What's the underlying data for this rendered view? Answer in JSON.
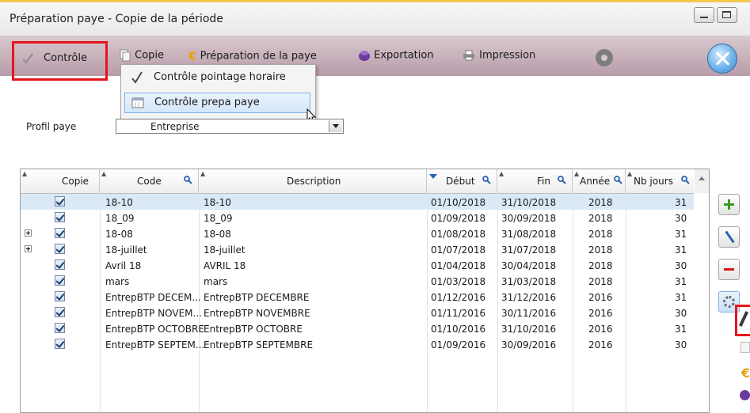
{
  "window": {
    "title": "Préparation paye - Copie de la période"
  },
  "toolbar": {
    "controle_label": "Contrôle",
    "copie_label": "Copie",
    "preparation_label": "Préparation de la paye",
    "exportation_label": "Exportation",
    "impression_label": "Impression"
  },
  "dropdown_menu": {
    "items": [
      {
        "label": "Contrôle pointage horaire",
        "icon": "checkmark-icon"
      },
      {
        "label": "Contrôle prepa paye",
        "icon": "calendar-icon"
      }
    ]
  },
  "profil": {
    "label": "Profil paye",
    "value": "Entreprise"
  },
  "grid": {
    "headers": [
      "Copie",
      "Code",
      "Description",
      "Début",
      "Fin",
      "Année",
      "Nb jours"
    ],
    "rows": [
      {
        "expand": false,
        "copie": true,
        "code": "18-10",
        "description": "18-10",
        "debut": "01/10/2018",
        "fin": "31/10/2018",
        "annee": "2018",
        "nbjours": "31"
      },
      {
        "expand": false,
        "copie": true,
        "code": "18_09",
        "description": "18_09",
        "debut": "01/09/2018",
        "fin": "30/09/2018",
        "annee": "2018",
        "nbjours": "30"
      },
      {
        "expand": true,
        "copie": true,
        "code": "18-08",
        "description": "18-08",
        "debut": "01/08/2018",
        "fin": "31/08/2018",
        "annee": "2018",
        "nbjours": "31"
      },
      {
        "expand": true,
        "copie": true,
        "code": "18-juillet",
        "description": "18-juillet",
        "debut": "01/07/2018",
        "fin": "31/07/2018",
        "annee": "2018",
        "nbjours": "31"
      },
      {
        "expand": false,
        "copie": true,
        "code": "Avril 18",
        "description": "AVRIL 18",
        "debut": "01/04/2018",
        "fin": "30/04/2018",
        "annee": "2018",
        "nbjours": "30"
      },
      {
        "expand": false,
        "copie": true,
        "code": "mars",
        "description": "mars",
        "debut": "01/03/2018",
        "fin": "31/03/2018",
        "annee": "2018",
        "nbjours": "31"
      },
      {
        "expand": false,
        "copie": true,
        "code": "EntrepBTP DECEM...",
        "description": "EntrepBTP DECEMBRE",
        "debut": "01/12/2016",
        "fin": "31/12/2016",
        "annee": "2016",
        "nbjours": "31"
      },
      {
        "expand": false,
        "copie": true,
        "code": "EntrepBTP NOVEM...",
        "description": "EntrepBTP NOVEMBRE",
        "debut": "01/11/2016",
        "fin": "30/11/2016",
        "annee": "2016",
        "nbjours": "30"
      },
      {
        "expand": false,
        "copie": true,
        "code": "EntrepBTP OCTOBRE",
        "description": "EntrepBTP OCTOBRE",
        "debut": "01/10/2016",
        "fin": "31/10/2016",
        "annee": "2016",
        "nbjours": "31"
      },
      {
        "expand": false,
        "copie": true,
        "code": "EntrepBTP SEPTEM...",
        "description": "EntrepBTP SEPTEMBRE",
        "debut": "01/09/2016",
        "fin": "30/09/2016",
        "annee": "2016",
        "nbjours": "30"
      }
    ]
  },
  "colors": {
    "toolbar_top": "#d8c8cf",
    "toolbar_bottom": "#b89ca9",
    "highlight_red": "#e8141b",
    "selection_blue": "#dbe9f7"
  }
}
